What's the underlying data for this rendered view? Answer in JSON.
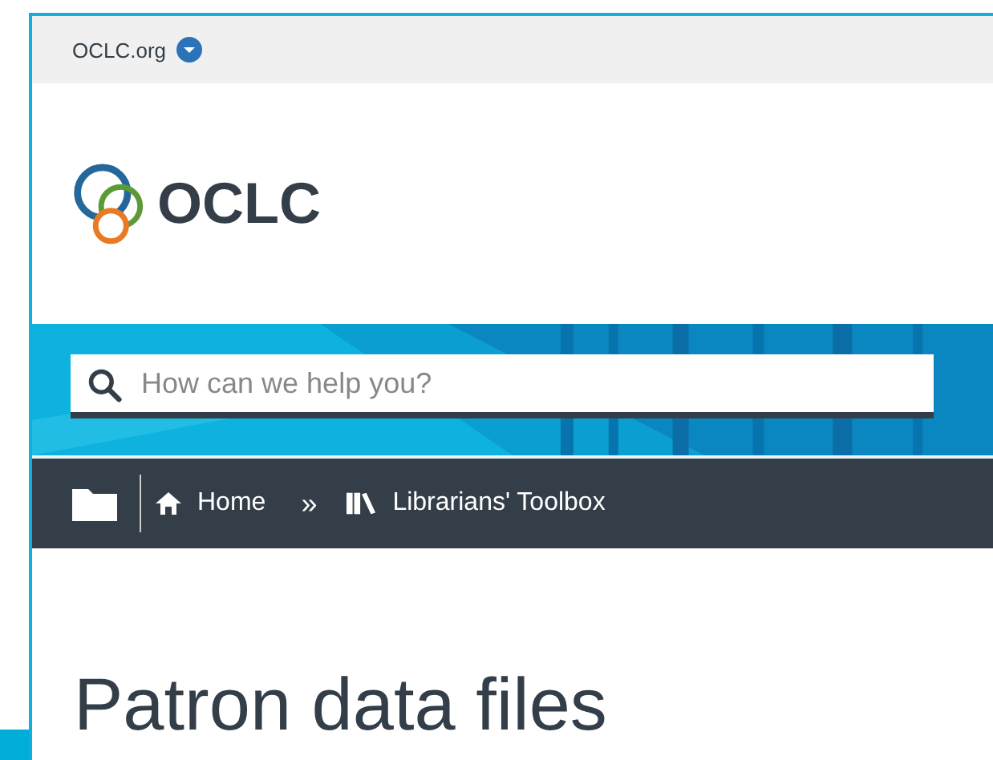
{
  "top_bar": {
    "link": "OCLC.org"
  },
  "logo": {
    "text": "OCLC"
  },
  "search": {
    "placeholder": "How can we help you?"
  },
  "breadcrumb": {
    "items": [
      {
        "kind": "home",
        "label": "Home"
      },
      {
        "kind": "books",
        "label": "Librarians' Toolbox"
      }
    ],
    "separator": "»"
  },
  "page_title": "Patron data files"
}
